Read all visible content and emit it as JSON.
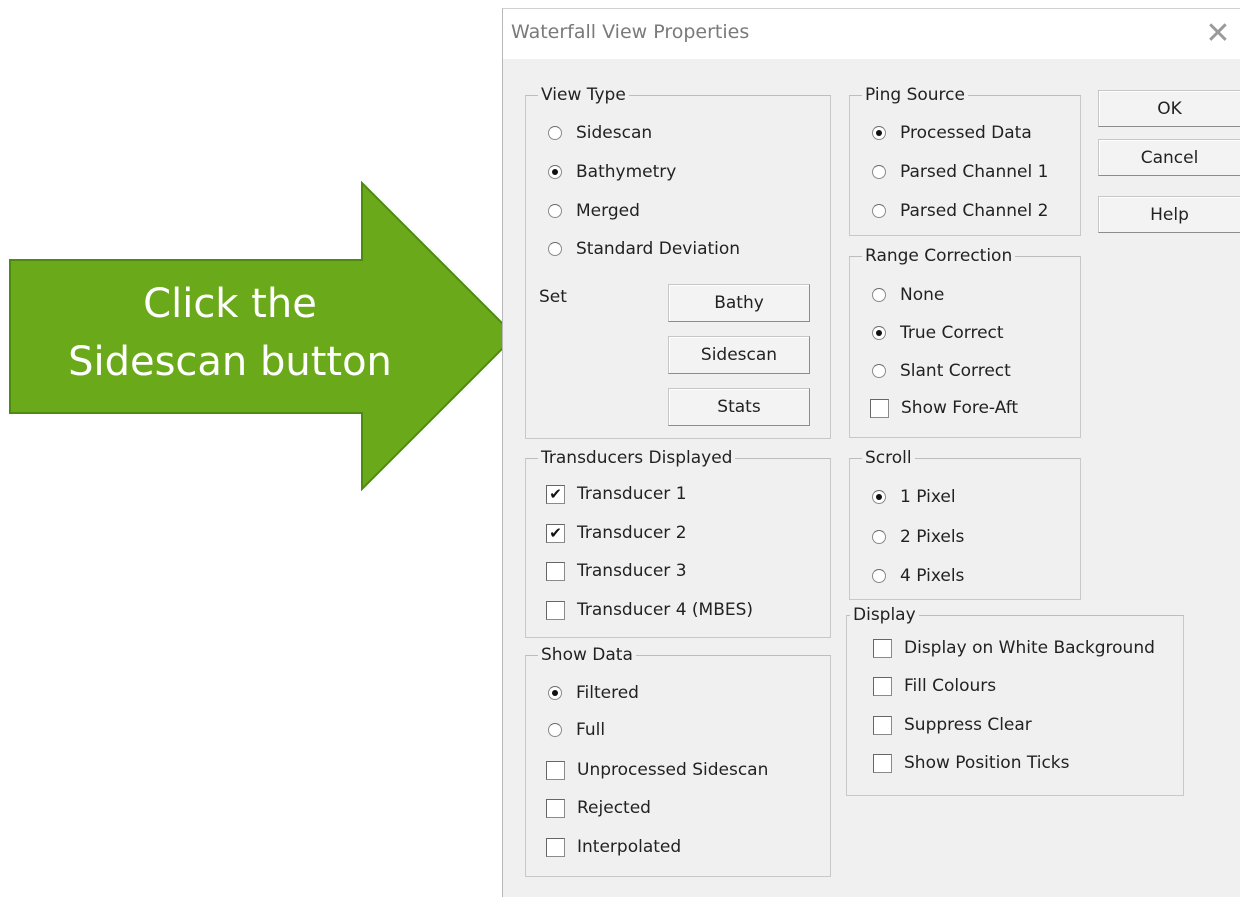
{
  "annotation": {
    "line1": "Click the",
    "line2": "Sidescan button",
    "color": "#6aaa1a"
  },
  "dialog": {
    "title": "Waterfall View Properties",
    "close_glyph": "✕",
    "buttons": {
      "ok": "OK",
      "cancel": "Cancel",
      "help": "Help"
    }
  },
  "view_type": {
    "legend": "View Type",
    "options": [
      {
        "label": "Sidescan",
        "selected": false
      },
      {
        "label": "Bathymetry",
        "selected": true
      },
      {
        "label": "Merged",
        "selected": false
      },
      {
        "label": "Standard Deviation",
        "selected": false
      }
    ],
    "set_label": "Set",
    "set_buttons": [
      "Bathy",
      "Sidescan",
      "Stats"
    ]
  },
  "ping_source": {
    "legend": "Ping Source",
    "options": [
      {
        "label": "Processed Data",
        "selected": true
      },
      {
        "label": "Parsed Channel 1",
        "selected": false
      },
      {
        "label": "Parsed Channel 2",
        "selected": false
      }
    ]
  },
  "range_correction": {
    "legend": "Range Correction",
    "options": [
      {
        "label": "None",
        "selected": false
      },
      {
        "label": "True Correct",
        "selected": true
      },
      {
        "label": "Slant Correct",
        "selected": false
      }
    ],
    "checkbox": {
      "label": "Show Fore-Aft",
      "checked": false
    }
  },
  "transducers": {
    "legend": "Transducers Displayed",
    "items": [
      {
        "label": "Transducer 1",
        "checked": true
      },
      {
        "label": "Transducer 2",
        "checked": true
      },
      {
        "label": "Transducer 3",
        "checked": false
      },
      {
        "label": "Transducer 4 (MBES)",
        "checked": false
      }
    ]
  },
  "scroll": {
    "legend": "Scroll",
    "options": [
      {
        "label": "1 Pixel",
        "selected": true
      },
      {
        "label": "2 Pixels",
        "selected": false
      },
      {
        "label": "4 Pixels",
        "selected": false
      }
    ]
  },
  "show_data": {
    "legend": "Show Data",
    "options": [
      {
        "label": "Filtered",
        "selected": true
      },
      {
        "label": "Full",
        "selected": false
      }
    ],
    "checkboxes": [
      {
        "label": "Unprocessed Sidescan",
        "checked": false
      },
      {
        "label": "Rejected",
        "checked": false
      },
      {
        "label": "Interpolated",
        "checked": false
      }
    ]
  },
  "display": {
    "legend": "Display",
    "checkboxes": [
      {
        "label": "Display on White Background",
        "checked": false
      },
      {
        "label": "Fill Colours",
        "checked": false
      },
      {
        "label": "Suppress Clear",
        "checked": false
      },
      {
        "label": "Show Position Ticks",
        "checked": false
      }
    ]
  }
}
